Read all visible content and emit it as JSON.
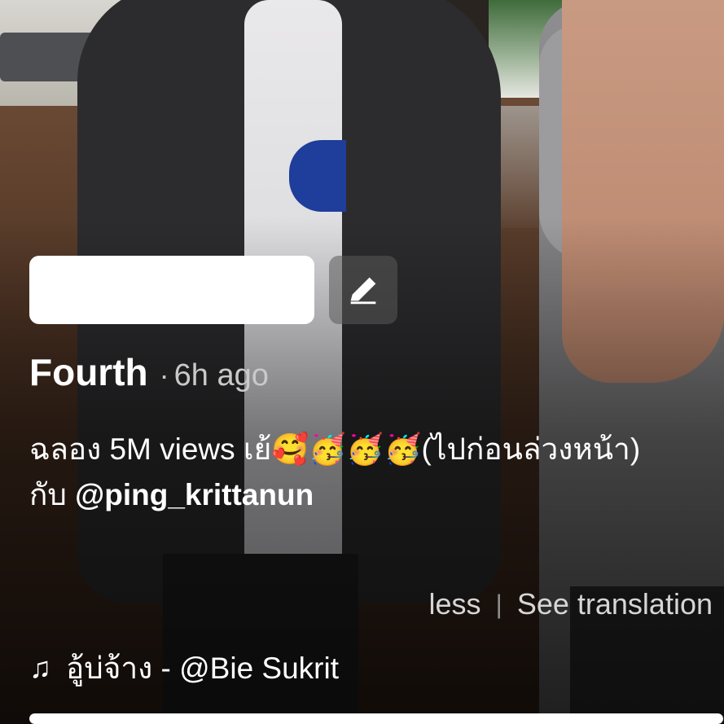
{
  "post": {
    "author": "Fourth",
    "separator": "·",
    "time_ago": "6h ago",
    "caption_line1": "ฉลอง 5M views เย้🥰🥳🥳🥳(ไปก่อนล่วงหน้า)",
    "caption_prefix": "กับ ",
    "mention": "@ping_krittanun",
    "less_label": "less",
    "divider": "|",
    "translate_label": "See translation"
  },
  "music": {
    "icon": "music-note-icon",
    "icon_glyph": "♫",
    "title": "อู้บ่จ้าง - @Bie Sukrit"
  },
  "editor": {
    "input_value": "",
    "edit_icon": "pencil-icon"
  },
  "playback": {
    "progress_fraction": 1.0
  },
  "colors": {
    "text_primary": "#ffffff",
    "text_secondary": "#c9c9c9",
    "input_bg": "#ffffff"
  }
}
